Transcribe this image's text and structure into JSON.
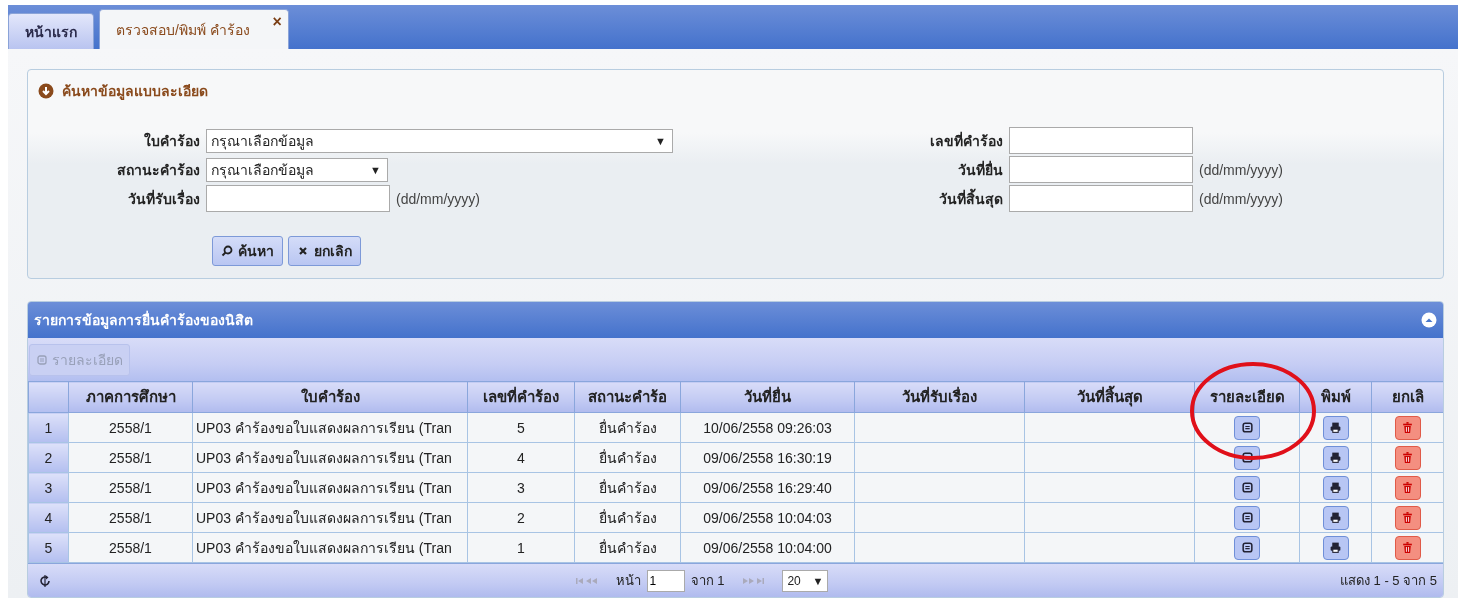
{
  "tabs": [
    {
      "label": "หน้าแรก",
      "selected": false
    },
    {
      "label": "ตรวจสอบ/พิมพ์ คำร้อง",
      "selected": true,
      "close": "×"
    }
  ],
  "search_panel": {
    "title": "ค้นหาข้อมูลแบบละเอียด",
    "fields_left": [
      {
        "label": "ใบคำร้อง",
        "kind": "select",
        "value": "กรุณาเลือกข้อมูล",
        "caret": "▼",
        "wide": true
      },
      {
        "label": "สถานะคำร้อง",
        "kind": "select",
        "value": "กรุณาเลือกข้อมูล",
        "caret": "▼",
        "wide": false
      },
      {
        "label": "วันที่รับเรื่อง",
        "kind": "date",
        "hint": "(dd/mm/yyyy)"
      }
    ],
    "fields_right": [
      {
        "label": "เลขที่คำร้อง"
      },
      {
        "label": "วันที่ยื่น",
        "hint": "(dd/mm/yyyy)"
      },
      {
        "label": "วันที่สิ้นสุด",
        "hint": "(dd/mm/yyyy)"
      }
    ],
    "buttons": [
      {
        "label": "ค้นหา",
        "kind": "search"
      },
      {
        "label": "ยกเลิก",
        "kind": "cancel"
      }
    ]
  },
  "grid": {
    "title": "รายการข้อมูลการยื่นคำร้องของนิสิต",
    "toolbar_button": {
      "label": "รายละเอียด",
      "disabled": true
    },
    "columns": [
      "ภาคการศึกษา",
      "ใบคำร้อง",
      "เลขที่คำร้อง",
      "สถานะคำร้อ",
      "วันที่ยื่น",
      "วันที่รับเรื่อง",
      "วันที่สิ้นสุด",
      "รายละเอียด",
      "พิมพ์",
      "ยกเลิ"
    ],
    "rows": [
      {
        "num": "1",
        "term": "2558/1",
        "form": "UP03 คำร้องขอใบแสดงผลการเรียน (Tran",
        "no": "5",
        "status": "ยื่นคำร้อง",
        "filed": "10/06/2558 09:26:03"
      },
      {
        "num": "2",
        "term": "2558/1",
        "form": "UP03 คำร้องขอใบแสดงผลการเรียน (Tran",
        "no": "4",
        "status": "ยื่นคำร้อง",
        "filed": "09/06/2558 16:30:19"
      },
      {
        "num": "3",
        "term": "2558/1",
        "form": "UP03 คำร้องขอใบแสดงผลการเรียน (Tran",
        "no": "3",
        "status": "ยื่นคำร้อง",
        "filed": "09/06/2558 16:29:40"
      },
      {
        "num": "4",
        "term": "2558/1",
        "form": "UP03 คำร้องขอใบแสดงผลการเรียน (Tran",
        "no": "2",
        "status": "ยื่นคำร้อง",
        "filed": "09/06/2558 10:04:03"
      },
      {
        "num": "5",
        "term": "2558/1",
        "form": "UP03 คำร้องขอใบแสดงผลการเรียน (Tran",
        "no": "1",
        "status": "ยื่นคำร้อง",
        "filed": "09/06/2558 10:04:00"
      }
    ],
    "pager": {
      "page_label": "หน้า",
      "page": "1",
      "of": "จาก 1",
      "page_size": "20",
      "caret": "▼",
      "summary": "แสดง 1 - 5 จาก 5"
    }
  }
}
